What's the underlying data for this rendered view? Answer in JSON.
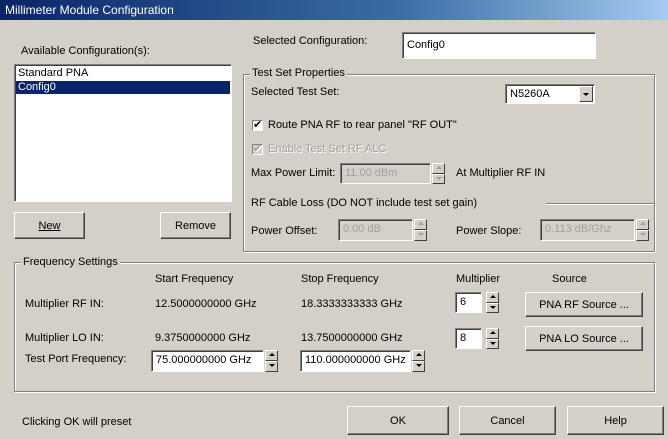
{
  "window": {
    "title": "Millimeter Module Configuration"
  },
  "configs": {
    "available_label": "Available Configuration(s):",
    "items": [
      {
        "label": "Standard PNA",
        "selected": false
      },
      {
        "label": "Config0",
        "selected": true
      }
    ],
    "new_button": "New",
    "remove_button": "Remove"
  },
  "selected_config": {
    "label": "Selected Configuration:",
    "value": "Config0"
  },
  "test_set": {
    "group_title": "Test Set Properties",
    "selected_label": "Selected Test Set:",
    "selected_value": "N5260A",
    "route_rf_label": "Route PNA RF to rear panel \"RF OUT\"",
    "route_rf_checked": true,
    "enable_alc_label": "Enable Test Set RF ALC",
    "enable_alc_checked": true,
    "max_power_label": "Max Power Limit:",
    "max_power_value": "11.00 dBm",
    "at_multiplier_label": "At Multiplier RF IN"
  },
  "cable_loss": {
    "group_title": "RF Cable Loss (DO NOT include test set gain)",
    "power_offset_label": "Power Offset:",
    "power_offset_value": "0.00 dB",
    "power_slope_label": "Power Slope:",
    "power_slope_value": "0.113 dB/Ghz"
  },
  "frequency": {
    "group_title": "Frequency Settings",
    "headers": {
      "start": "Start Frequency",
      "stop": "Stop Frequency",
      "multiplier": "Multiplier",
      "source": "Source"
    },
    "rf_in": {
      "label": "Multiplier RF IN:",
      "start": "12.5000000000 GHz",
      "stop": "18.3333333333 GHz",
      "multiplier": "6",
      "source_button": "PNA RF Source ..."
    },
    "lo_in": {
      "label": "Multiplier LO IN:",
      "start": "9.3750000000 GHz",
      "stop": "13.7500000000 GHz",
      "multiplier": "8",
      "source_button": "PNA LO Source ..."
    },
    "test_port": {
      "label": "Test Port Frequency:",
      "start": "75.000000000 GHz",
      "stop": "110.000000000 GHz"
    }
  },
  "footer": {
    "note": "Clicking OK will preset",
    "ok_button": "OK",
    "cancel_button": "Cancel",
    "help_button": "Help"
  }
}
